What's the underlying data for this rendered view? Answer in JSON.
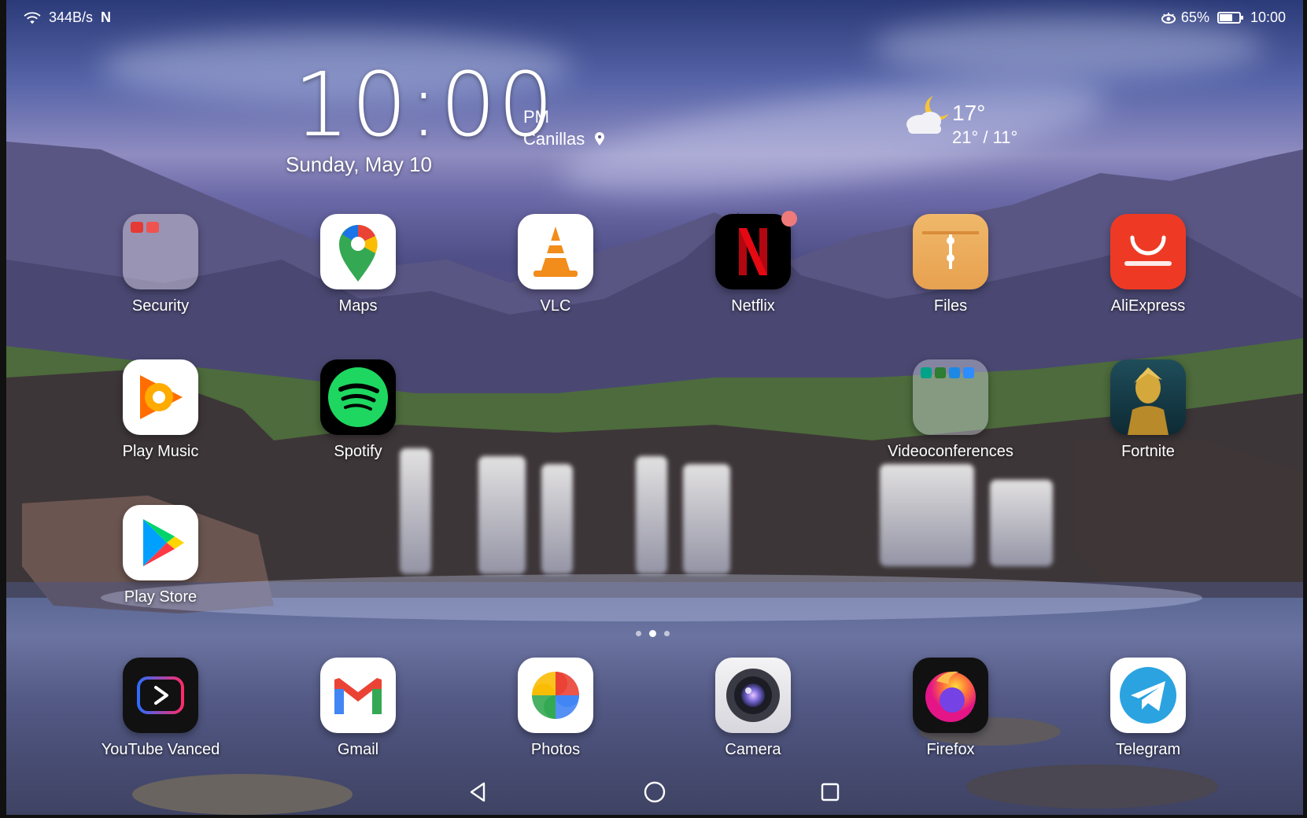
{
  "status_bar": {
    "net_speed": "344B/s",
    "nfc": "N",
    "battery_percent": "65%",
    "battery_level": 0.65,
    "time": "10:00"
  },
  "clock_widget": {
    "time": "10:00",
    "ampm": "PM",
    "location": "Canillas",
    "date": "Sunday, May 10"
  },
  "weather_widget": {
    "temperature": "17°",
    "range": "21° / 11°",
    "icon": "partly-cloudy-night-icon"
  },
  "apps": [
    {
      "label": "Security",
      "icon": "security-folder-icon"
    },
    {
      "label": "Maps",
      "icon": "google-maps-icon"
    },
    {
      "label": "VLC",
      "icon": "vlc-cone-icon"
    },
    {
      "label": "Netflix",
      "icon": "netflix-icon"
    },
    {
      "label": "Files",
      "icon": "files-icon"
    },
    {
      "label": "AliExpress",
      "icon": "aliexpress-icon"
    },
    {
      "label": "Play Music",
      "icon": "play-music-icon"
    },
    {
      "label": "Spotify",
      "icon": "spotify-icon"
    },
    {
      "label": "Videoconferences",
      "icon": "videoconferences-folder-icon"
    },
    {
      "label": "Fortnite",
      "icon": "fortnite-icon"
    },
    {
      "label": "Play Store",
      "icon": "play-store-icon"
    }
  ],
  "dock": [
    {
      "label": "YouTube Vanced",
      "icon": "youtube-vanced-icon"
    },
    {
      "label": "Gmail",
      "icon": "gmail-icon"
    },
    {
      "label": "Photos",
      "icon": "google-photos-icon"
    },
    {
      "label": "Camera",
      "icon": "camera-icon"
    },
    {
      "label": "Firefox",
      "icon": "firefox-icon"
    },
    {
      "label": "Telegram",
      "icon": "telegram-icon"
    }
  ],
  "colors": {
    "netflix_red": "#e50914",
    "spotify_green": "#1ed760",
    "aliexpress_red": "#ee3a24",
    "files_orange": "#e7a14f",
    "telegram_blue": "#2aa3e0",
    "vlc_orange": "#f28c1b",
    "badge": "#ef7a7a"
  },
  "page_indicator": {
    "count": 3,
    "active_index": 1
  }
}
